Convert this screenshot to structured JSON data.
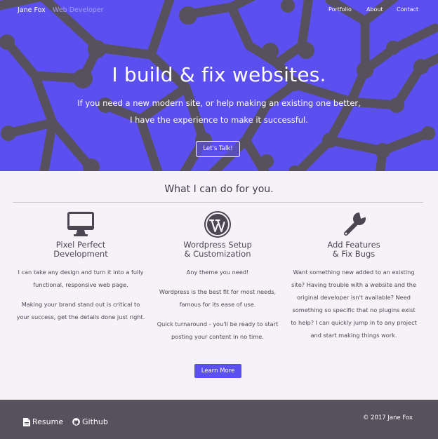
{
  "nav": {
    "brand_name": "Jane Fox",
    "brand_role": "Web Developer",
    "links": [
      "Portfolio",
      "About",
      "Contact"
    ]
  },
  "hero": {
    "title": "I build & fix websites.",
    "line1": "If you need a new modern site, or help making an existing one better,",
    "line2": "I have the experience to make it successful.",
    "cta": "Let's Talk!"
  },
  "services": {
    "title": "What I can do for you.",
    "items": [
      {
        "icon": "desktop-icon",
        "title_line1": "Pixel Perfect",
        "title_line2": "Development",
        "para1_lines": [
          "I can take any design and turn it into a fully",
          "functional, responsive web page."
        ],
        "para2_lines": [
          "Making your brand stand out is critical to",
          "your success, get the details done just right."
        ]
      },
      {
        "icon": "wordpress-icon",
        "title_line1": "Wordpress Setup",
        "title_line2": "& Customization",
        "para1_lines": [
          "Any theme you need!"
        ],
        "para2_lines": [
          "Wordpress is the best fit for most needs,",
          "famous for its ease of use."
        ],
        "para3_lines": [
          "Quick turnaround - you'll be ready to start",
          "posting your content in no time."
        ]
      },
      {
        "icon": "wrench-icon",
        "title_line1": "Add Features",
        "title_line2": "& Fix Bugs",
        "para1_lines": [
          "Want something new added to an existing",
          "site? Having trouble with a website and the",
          "original developer isn't available? Need",
          "something so specific that no plugins exist",
          "to help? I can quickly jump in to any project",
          "and start making things work."
        ]
      }
    ],
    "button": "Learn More"
  },
  "footer": {
    "resume": "Resume",
    "github": "Github",
    "copyright": "© 2017 Jane Fox"
  },
  "colors": {
    "accent": "#5b4ff0",
    "pattern": "#56515c",
    "footer": "#56515c",
    "background": "#f6f3f8"
  }
}
